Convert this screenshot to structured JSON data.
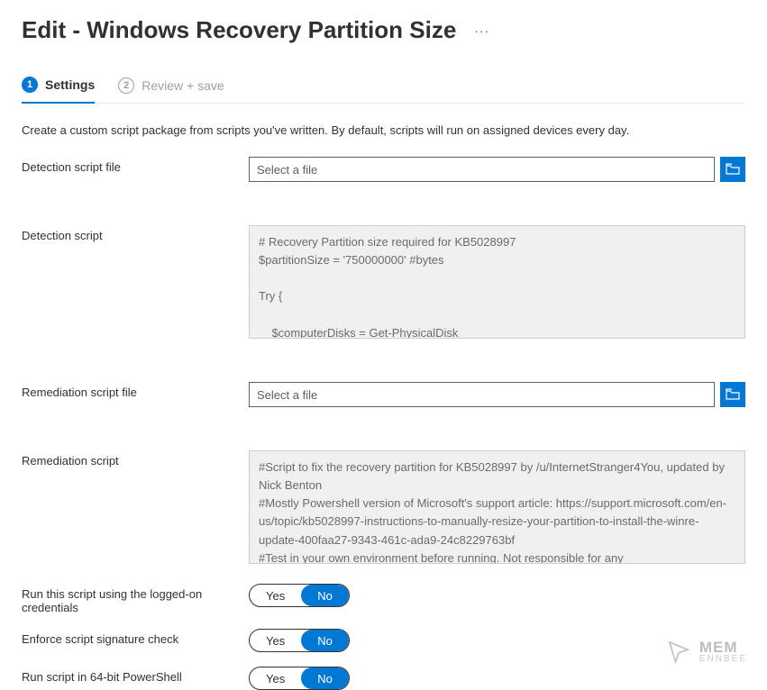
{
  "header": {
    "title": "Edit - Windows Recovery Partition Size"
  },
  "tabs": {
    "items": [
      {
        "step": "1",
        "label": "Settings",
        "active": true
      },
      {
        "step": "2",
        "label": "Review + save",
        "active": false
      }
    ]
  },
  "intro": "Create a custom script package from scripts you've written. By default, scripts will run on assigned devices every day.",
  "form": {
    "detection_file_label": "Detection script file",
    "detection_file_placeholder": "Select a file",
    "detection_script_label": "Detection script",
    "detection_script_content": "# Recovery Partition size required for KB5028997\n$partitionSize = '750000000' #bytes\n\nTry {\n\n    $computerDisks = Get-PhysicalDisk\n    foreach ($computerDisk in $computerDisks) {",
    "remediation_file_label": "Remediation script file",
    "remediation_file_placeholder": "Select a file",
    "remediation_script_label": "Remediation script",
    "remediation_script_content": "#Script to fix the recovery partition for KB5028997 by /u/InternetStranger4You, updated by Nick Benton\n#Mostly Powershell version of Microsoft's support article: https://support.microsoft.com/en-us/topic/kb5028997-instructions-to-manually-resize-your-partition-to-install-the-winre-update-400faa27-9343-461c-ada9-24c8229763bf\n#Test in your own environment before running. Not responsible for any",
    "logged_on_label": "Run this script using the logged-on credentials",
    "signature_label": "Enforce script signature check",
    "bit64_label": "Run script in 64-bit PowerShell",
    "toggle_yes": "Yes",
    "toggle_no": "No"
  },
  "watermark": {
    "line1": "MEM",
    "line2": "ENNBEE"
  }
}
